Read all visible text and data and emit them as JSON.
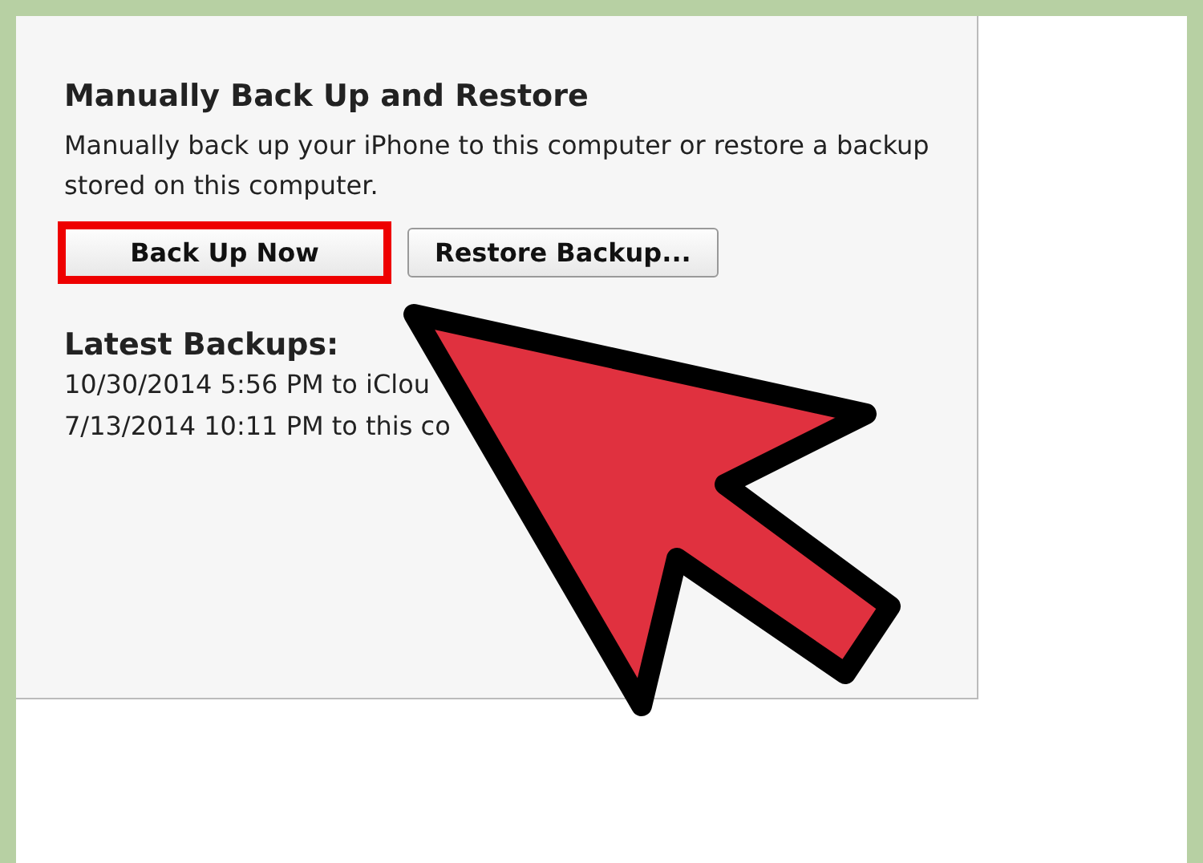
{
  "section": {
    "title": "Manually Back Up and Restore",
    "description": "Manually back up your iPhone to this computer or restore a backup stored on this computer."
  },
  "buttons": [
    {
      "label": "Back Up Now",
      "highlighted": true
    },
    {
      "label": "Restore Backup...",
      "highlighted": false
    }
  ],
  "latest_backups": {
    "title": "Latest Backups:",
    "entries": [
      "10/30/2014 5:56 PM to iClou",
      "7/13/2014 10:11 PM to this co"
    ]
  }
}
